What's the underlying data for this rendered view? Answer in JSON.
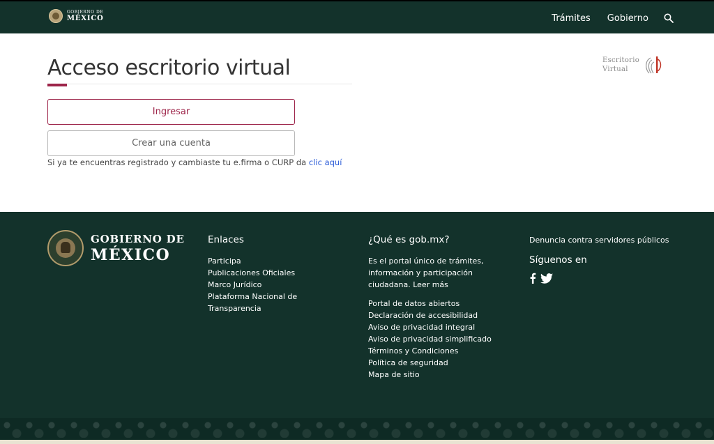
{
  "header": {
    "logo": {
      "line1": "GOBIERNO DE",
      "line2": "MÉXICO"
    },
    "nav": [
      {
        "label": "Trámites"
      },
      {
        "label": "Gobierno"
      }
    ]
  },
  "main": {
    "title": "Acceso escritorio virtual",
    "login_label": "Ingresar",
    "create_label": "Crear una cuenta",
    "note_text": "Si ya te encuentras registrado y cambiaste tu e.firma o CURP da ",
    "note_link": "clic aquí",
    "brand": {
      "line1": "Escritorio",
      "line2": "Virtual"
    }
  },
  "footer": {
    "logo": {
      "line1": "GOBIERNO DE",
      "line2": "MÉXICO"
    },
    "links": {
      "heading": "Enlaces",
      "items": [
        "Participa",
        "Publicaciones Oficiales",
        "Marco Jurídico",
        "Plataforma Nacional de Transparencia"
      ]
    },
    "about": {
      "heading": "¿Qué es gob.mx?",
      "description": "Es el portal único de trámites, información y participación ciudadana. Leer más",
      "items": [
        "Portal de datos abiertos",
        "Declaración de accesibilidad",
        "Aviso de privacidad integral",
        "Aviso de privacidad simplificado",
        "Términos y Condiciones",
        "Política de seguridad",
        "Mapa de sitio"
      ]
    },
    "social": {
      "denuncia": "Denuncia contra servidores públicos",
      "heading": "Síguenos en",
      "icons": [
        "facebook-icon",
        "twitter-icon"
      ]
    }
  },
  "colors": {
    "primary_green": "#13322b",
    "accent_red": "#9d2449",
    "link_blue": "#2a5bd7"
  }
}
